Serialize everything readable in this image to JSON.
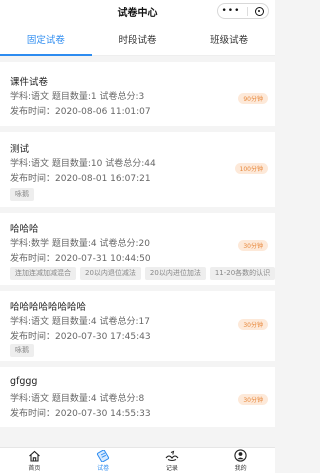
{
  "nav": {
    "title": "试卷中心"
  },
  "tabs": [
    {
      "label": "固定试卷"
    },
    {
      "label": "时段试卷"
    },
    {
      "label": "班级试卷"
    }
  ],
  "exams": [
    {
      "title": "课件试卷",
      "info": "学科:语文   题目数量:1   试卷总分:3",
      "time": "发布时间：2020-08-06 11:01:07",
      "duration": "90分钟",
      "tags": []
    },
    {
      "title": "测试",
      "info": "学科:语文   题目数量:10   试卷总分:44",
      "time": "发布时间：2020-08-01 16:07:21",
      "duration": "100分钟",
      "tags": [
        "咏鹅"
      ]
    },
    {
      "title": "哈哈哈",
      "info": "学科:数学   题目数量:4   试卷总分:20",
      "time": "发布时间：2020-07-31 10:44:50",
      "duration": "30分钟",
      "tags": [
        "连加连减加减混合",
        "20以内退位减法",
        "20以内进位加法",
        "11-20各数的认识"
      ]
    },
    {
      "title": "哈哈哈哈哈哈哈哈",
      "info": "学科:语文   题目数量:4   试卷总分:17",
      "time": "发布时间：2020-07-30 17:45:43",
      "duration": "30分钟",
      "tags": [
        "咏鹅"
      ]
    },
    {
      "title": "gfggg",
      "info": "学科:语文   题目数量:4   试卷总分:8",
      "time": "发布时间：2020-07-30 14:55:33",
      "duration": "30分钟",
      "tags": []
    }
  ],
  "tabbar": [
    {
      "label": "首页",
      "icon": "home-icon"
    },
    {
      "label": "试卷",
      "icon": "exam-icon"
    },
    {
      "label": "记录",
      "icon": "record-icon"
    },
    {
      "label": "我的",
      "icon": "user-icon"
    }
  ],
  "colors": {
    "accent": "#2d8cf0",
    "badge_bg": "#fde9d9",
    "badge_text": "#e7873a"
  }
}
